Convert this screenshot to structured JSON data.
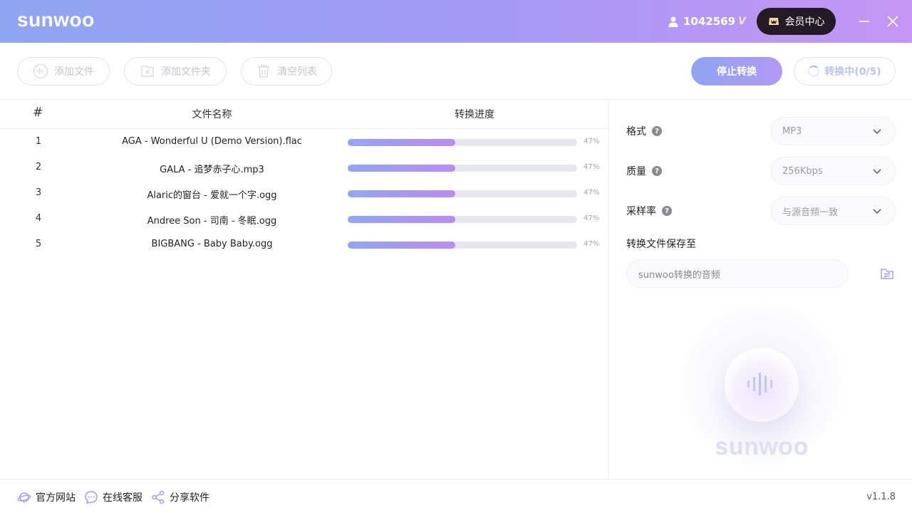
{
  "app": {
    "logo": "sunwoo",
    "user_id": "1042569",
    "vip_mark": "V",
    "vip_center_label": "会员中心",
    "colors": {
      "accent_start": "#8ea4f2",
      "accent_end": "#b98cf2",
      "vip_bg": "#241a26"
    }
  },
  "toolbar": {
    "add_file_label": "添加文件",
    "add_folder_label": "添加文件夹",
    "clear_list_label": "清空列表",
    "stop_convert_label": "停止转换",
    "status_label": "转换中(0/5)"
  },
  "table": {
    "headers": {
      "index": "#",
      "name": "文件名称",
      "progress": "转换进度"
    },
    "rows": [
      {
        "index": "1",
        "name": "AGA - Wonderful U (Demo Version).flac",
        "progress": 47,
        "progress_label": "47%"
      },
      {
        "index": "2",
        "name": "GALA - 追梦赤子心.mp3",
        "progress": 47,
        "progress_label": "47%"
      },
      {
        "index": "3",
        "name": "Alaric的窗台 - 爱就一个字.ogg",
        "progress": 47,
        "progress_label": "47%"
      },
      {
        "index": "4",
        "name": "Andree Son - 司南 - 冬眠.ogg",
        "progress": 47,
        "progress_label": "47%"
      },
      {
        "index": "5",
        "name": "BIGBANG - Baby Baby.ogg",
        "progress": 47,
        "progress_label": "47%"
      }
    ]
  },
  "settings": {
    "format_label": "格式",
    "format_value": "MP3",
    "quality_label": "质量",
    "quality_value": "256Kbps",
    "samplerate_label": "采样率",
    "samplerate_value": "与源音频一致",
    "save_to_label": "转换文件保存至",
    "save_to_value": "sunwoo转换的音频",
    "help_glyph": "?"
  },
  "decoration": {
    "logo": "sunwoo"
  },
  "footer": {
    "official_site_label": "官方网站",
    "online_service_label": "在线客服",
    "share_label": "分享软件",
    "version": "v1.1.8"
  }
}
